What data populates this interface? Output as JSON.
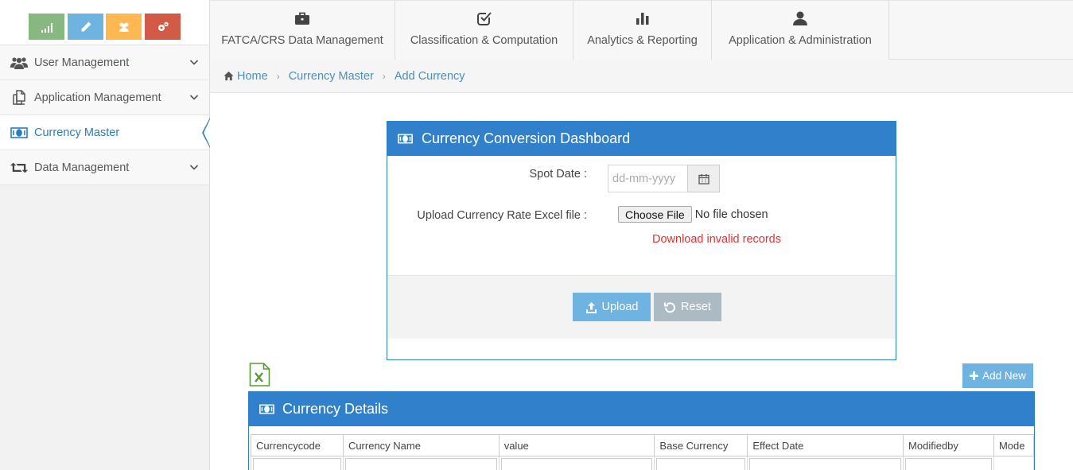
{
  "sidebar": {
    "shortcuts": [
      {
        "name": "stats",
        "icon": "signal-icon",
        "color": "#87b87f"
      },
      {
        "name": "edit",
        "icon": "pencil-icon",
        "color": "#6fb3e0"
      },
      {
        "name": "users",
        "icon": "users-icon",
        "color": "#ffb752"
      },
      {
        "name": "settings",
        "icon": "cogs-icon",
        "color": "#d15b47"
      }
    ],
    "items": [
      {
        "label": "User Management",
        "icon": "users-icon",
        "expandable": true
      },
      {
        "label": "Application Management",
        "icon": "copy-icon",
        "expandable": true
      },
      {
        "label": "Currency Master",
        "icon": "money-icon",
        "expandable": false,
        "active": true
      },
      {
        "label": "Data Management",
        "icon": "retweet-icon",
        "expandable": true
      }
    ]
  },
  "top_tabs": [
    {
      "label": "FATCA/CRS Data Management",
      "icon": "briefcase-icon"
    },
    {
      "label": "Classification & Computation",
      "icon": "check-circle-icon"
    },
    {
      "label": "Analytics & Reporting",
      "icon": "bar-chart-icon"
    },
    {
      "label": "Application & Administration",
      "icon": "user-icon"
    }
  ],
  "breadcrumb": {
    "home": "Home",
    "items": [
      "Currency Master",
      "Add Currency"
    ]
  },
  "dashboard": {
    "title": "Currency Conversion Dashboard",
    "spot_date_label": "Spot Date :",
    "spot_date_placeholder": "dd-mm-yyyy",
    "upload_label": "Upload Currency Rate Excel file :",
    "choose_file": "Choose File",
    "no_file": "No file chosen",
    "download_invalid": "Download invalid records",
    "upload_button": "Upload",
    "reset_button": "Reset"
  },
  "details": {
    "add_new": "Add New",
    "title": "Currency Details",
    "columns": [
      "Currencycode",
      "Currency Name",
      "value",
      "Base Currency",
      "Effect Date",
      "Modifiedby",
      "Mode"
    ]
  },
  "colors": {
    "primary": "#3180cc",
    "accent": "#6fb3e0",
    "danger": "#dd3333",
    "link": "#4c8fbd"
  }
}
